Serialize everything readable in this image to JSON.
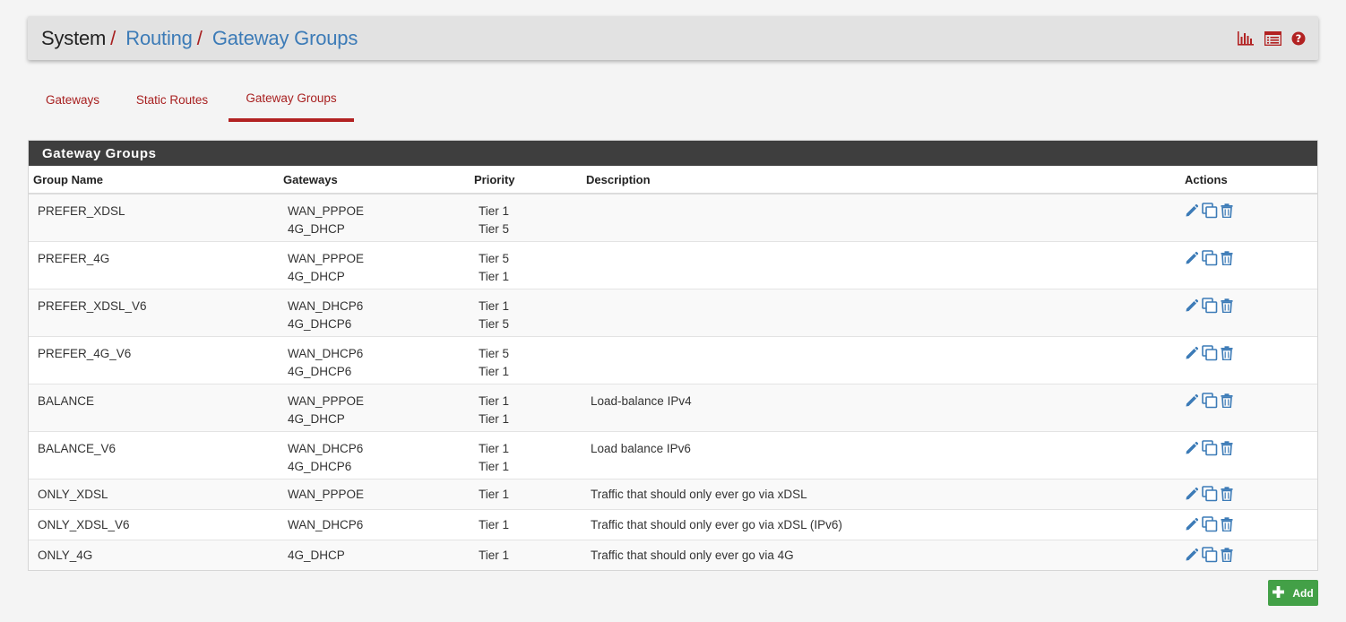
{
  "breadcrumb": {
    "root": "System",
    "separator": "/",
    "items": [
      "Routing",
      "Gateway Groups"
    ]
  },
  "header_icons": [
    "bar-chart-icon",
    "log-list-icon",
    "help-icon"
  ],
  "tabs": [
    {
      "label": "Gateways",
      "active": false
    },
    {
      "label": "Static Routes",
      "active": false
    },
    {
      "label": "Gateway Groups",
      "active": true
    }
  ],
  "panel": {
    "title": "Gateway Groups",
    "columns": [
      "Group Name",
      "Gateways",
      "Priority",
      "Description",
      "Actions"
    ],
    "rows": [
      {
        "name": "PREFER_XDSL",
        "gateways": [
          "WAN_PPPOE",
          "4G_DHCP"
        ],
        "priorities": [
          "Tier 1",
          "Tier 5"
        ],
        "description": ""
      },
      {
        "name": "PREFER_4G",
        "gateways": [
          "WAN_PPPOE",
          "4G_DHCP"
        ],
        "priorities": [
          "Tier 5",
          "Tier 1"
        ],
        "description": ""
      },
      {
        "name": "PREFER_XDSL_V6",
        "gateways": [
          "WAN_DHCP6",
          "4G_DHCP6"
        ],
        "priorities": [
          "Tier 1",
          "Tier 5"
        ],
        "description": ""
      },
      {
        "name": "PREFER_4G_V6",
        "gateways": [
          "WAN_DHCP6",
          "4G_DHCP6"
        ],
        "priorities": [
          "Tier 5",
          "Tier 1"
        ],
        "description": ""
      },
      {
        "name": "BALANCE",
        "gateways": [
          "WAN_PPPOE",
          "4G_DHCP"
        ],
        "priorities": [
          "Tier 1",
          "Tier 1"
        ],
        "description": "Load-balance IPv4"
      },
      {
        "name": "BALANCE_V6",
        "gateways": [
          "WAN_DHCP6",
          "4G_DHCP6"
        ],
        "priorities": [
          "Tier 1",
          "Tier 1"
        ],
        "description": "Load balance IPv6"
      },
      {
        "name": "ONLY_XDSL",
        "gateways": [
          "WAN_PPPOE"
        ],
        "priorities": [
          "Tier 1"
        ],
        "description": "Traffic that should only ever go via xDSL"
      },
      {
        "name": "ONLY_XDSL_V6",
        "gateways": [
          "WAN_DHCP6"
        ],
        "priorities": [
          "Tier 1"
        ],
        "description": "Traffic that should only ever go via xDSL (IPv6)"
      },
      {
        "name": "ONLY_4G",
        "gateways": [
          "4G_DHCP"
        ],
        "priorities": [
          "Tier 1"
        ],
        "description": "Traffic that should only ever go via 4G"
      }
    ],
    "row_actions": [
      "edit-icon",
      "copy-icon",
      "delete-icon"
    ]
  },
  "add_button": {
    "label": "Add",
    "icon": "plus-icon"
  },
  "colors": {
    "brand_red": "#a82020",
    "link_blue": "#3c7bb7",
    "panel_heading": "#3e3e3e",
    "add_green": "#43a047",
    "action_icon": "#3c7bb7"
  }
}
